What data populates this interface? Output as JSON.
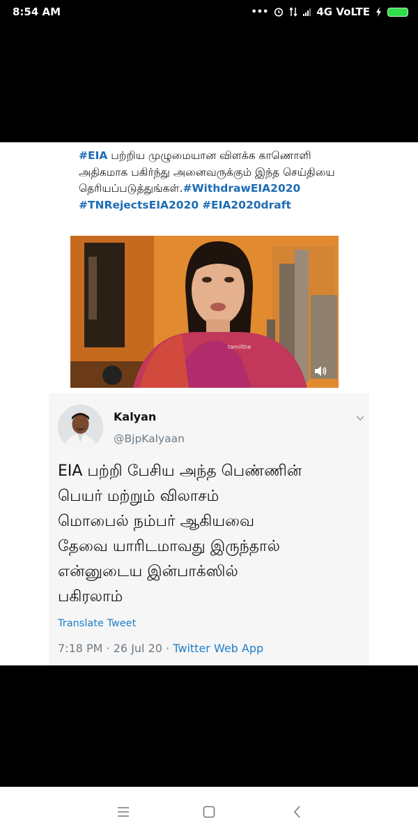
{
  "status_bar": {
    "time": "8:54 AM",
    "icons": [
      "more-dots-icon",
      "alarm-icon",
      "data-transfer-icon",
      "signal-icon"
    ],
    "network": "4G VoLTE",
    "battery_color": "#2fdc4a"
  },
  "post": {
    "text_parts": [
      {
        "tag": "#EIA"
      },
      {
        "text": " பற்றிய முழுமையான விளக்க காணொளி அதிகமாக பகிர்ந்து அனைவருக்கும் இந்த செய்தியை தெரியப்படுத்துங்கள்."
      },
      {
        "tag": "#WithdrawEIA2020"
      },
      {
        "text": " "
      },
      {
        "tag": "#TNRejectsEIA2020"
      },
      {
        "text": " "
      },
      {
        "tag": "#EIA2020draft"
      }
    ],
    "video": {
      "watermark": "tamilthe",
      "icon": "speaker-icon"
    }
  },
  "tweet": {
    "display_name": "Kalyan",
    "handle": "@BjpKalyaan",
    "body_lines": [
      "EIA பற்றி பேசிய அந்த பெண்ணின்",
      "பெயர் மற்றும் விலாசம்",
      "மொபைல் நம்பர் ஆகியவை",
      "தேவை யாரிடமாவது இருந்தால்",
      "என்னுடைய இன்பாக்ஸில்",
      "பகிரலாம்"
    ],
    "translate_label": "Translate Tweet",
    "time": "7:18 PM",
    "separator": "·",
    "date": "26 Jul 20",
    "source": "Twitter Web App",
    "link_color": "#1d7ec9"
  },
  "nav_bar": {
    "icons": [
      "menu-icon",
      "home-square-icon",
      "back-icon"
    ]
  }
}
